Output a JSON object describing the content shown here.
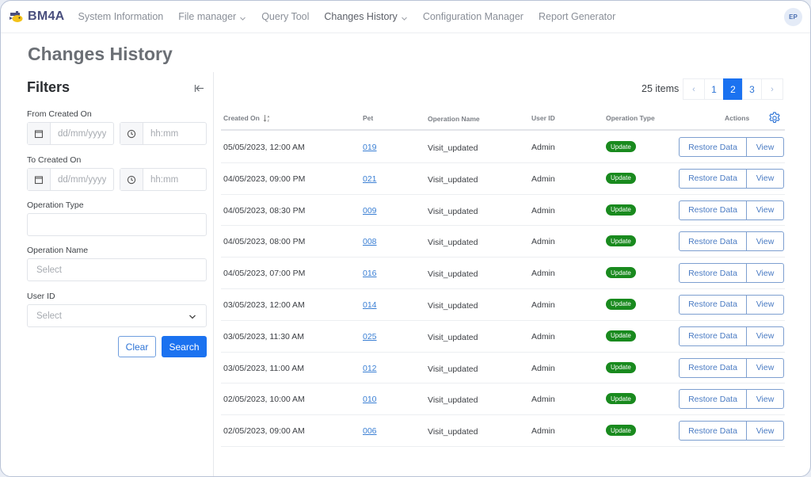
{
  "app": {
    "brand": "BM4A",
    "avatar_initials": "EP",
    "accent_color": "#1b72f0",
    "badge_color": "#198a1e"
  },
  "nav": {
    "items": [
      {
        "label": "System Information",
        "has_dropdown": false,
        "active": false
      },
      {
        "label": "File manager",
        "has_dropdown": true,
        "active": false
      },
      {
        "label": "Query Tool",
        "has_dropdown": false,
        "active": false
      },
      {
        "label": "Changes History",
        "has_dropdown": true,
        "active": true
      },
      {
        "label": "Configuration Manager",
        "has_dropdown": false,
        "active": false
      },
      {
        "label": "Report Generator",
        "has_dropdown": false,
        "active": false
      }
    ]
  },
  "page": {
    "title": "Changes History"
  },
  "filters": {
    "title": "Filters",
    "from_label": "From Created On",
    "to_label": "To Created On",
    "date_placeholder": "dd/mm/yyyy",
    "time_placeholder": "hh:mm",
    "operation_type_label": "Operation Type",
    "operation_type_value": "",
    "operation_name_label": "Operation Name",
    "operation_name_placeholder": "Select",
    "user_id_label": "User ID",
    "user_id_placeholder": "Select",
    "clear_label": "Clear",
    "search_label": "Search"
  },
  "pagination": {
    "items_text": "25 items",
    "prev": "‹",
    "next": "›",
    "pages": [
      "1",
      "2",
      "3"
    ],
    "current_page": "2"
  },
  "table": {
    "columns": {
      "created_on": "Created On",
      "pet": "Pet",
      "operation_name": "Operation Name",
      "user_id": "User ID",
      "operation_type": "Operation Type",
      "actions": "Actions"
    },
    "restore_label": "Restore Data",
    "view_label": "View",
    "rows": [
      {
        "created_on": "05/05/2023, 12:00 AM",
        "pet": "019",
        "operation_name": "Visit_updated",
        "user_id": "Admin",
        "operation_type": "Update"
      },
      {
        "created_on": "04/05/2023, 09:00 PM",
        "pet": "021",
        "operation_name": "Visit_updated",
        "user_id": "Admin",
        "operation_type": "Update"
      },
      {
        "created_on": "04/05/2023, 08:30 PM",
        "pet": "009",
        "operation_name": "Visit_updated",
        "user_id": "Admin",
        "operation_type": "Update"
      },
      {
        "created_on": "04/05/2023, 08:00 PM",
        "pet": "008",
        "operation_name": "Visit_updated",
        "user_id": "Admin",
        "operation_type": "Update"
      },
      {
        "created_on": "04/05/2023, 07:00 PM",
        "pet": "016",
        "operation_name": "Visit_updated",
        "user_id": "Admin",
        "operation_type": "Update"
      },
      {
        "created_on": "03/05/2023, 12:00 AM",
        "pet": "014",
        "operation_name": "Visit_updated",
        "user_id": "Admin",
        "operation_type": "Update"
      },
      {
        "created_on": "03/05/2023, 11:30 AM",
        "pet": "025",
        "operation_name": "Visit_updated",
        "user_id": "Admin",
        "operation_type": "Update"
      },
      {
        "created_on": "03/05/2023, 11:00 AM",
        "pet": "012",
        "operation_name": "Visit_updated",
        "user_id": "Admin",
        "operation_type": "Update"
      },
      {
        "created_on": "02/05/2023, 10:00 AM",
        "pet": "010",
        "operation_name": "Visit_updated",
        "user_id": "Admin",
        "operation_type": "Update"
      },
      {
        "created_on": "02/05/2023, 09:00 AM",
        "pet": "006",
        "operation_name": "Visit_updated",
        "user_id": "Admin",
        "operation_type": "Update"
      }
    ]
  }
}
